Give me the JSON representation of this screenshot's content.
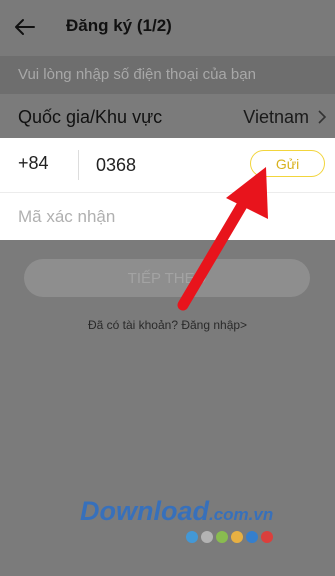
{
  "header": {
    "title": "Đăng ký (1/2)"
  },
  "hint": {
    "text": "Vui lòng nhập số điện thoại của bạn"
  },
  "country": {
    "label": "Quốc gia/Khu vực",
    "value": "Vietnam"
  },
  "phone": {
    "code": "+84",
    "value": "0368"
  },
  "send_button": {
    "label": "Gửi"
  },
  "code_field": {
    "placeholder": "Mã xác nhận"
  },
  "next_button": {
    "label": "TIẾP THEO"
  },
  "login_link": {
    "text": "Đã có tài khoản? Đăng nhập>"
  },
  "watermark": {
    "main": "Download",
    "suffix": ".com.vn"
  },
  "colors": {
    "arrow": "#e8141c",
    "send_border": "#f2d53c",
    "dots": [
      "#3d9be0",
      "#b9b9b9",
      "#8bc34a",
      "#f4b63c",
      "#2d7fd6",
      "#e53935"
    ]
  }
}
